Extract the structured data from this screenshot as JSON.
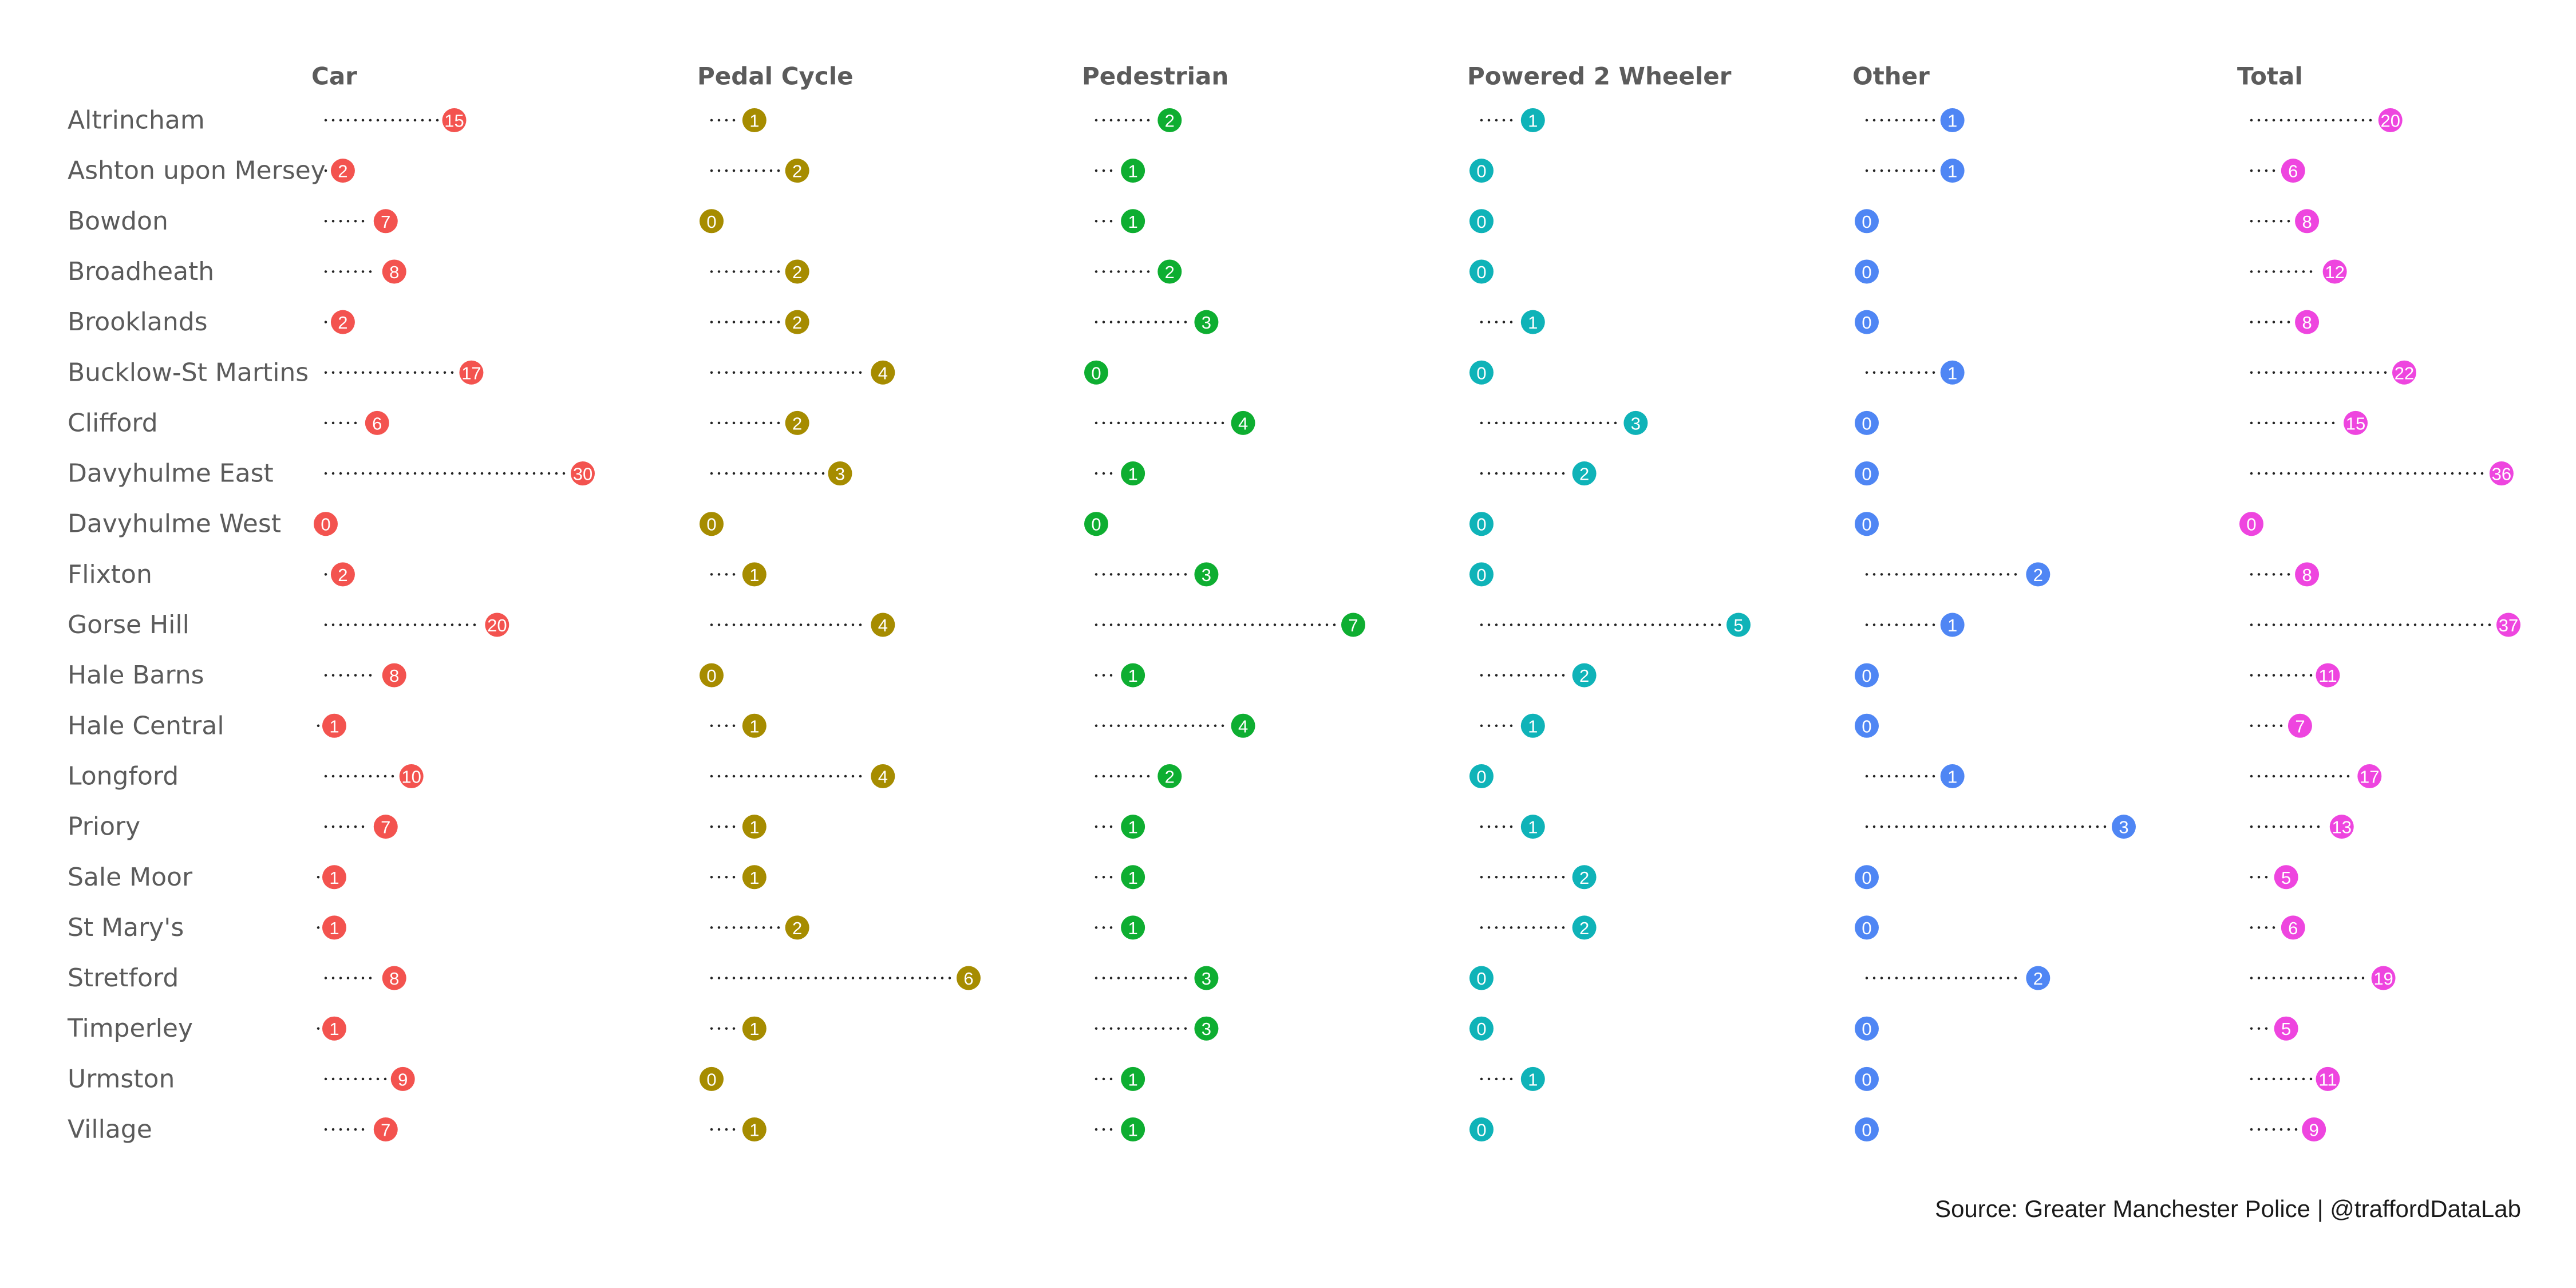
{
  "chart_data": {
    "type": "dot-strip",
    "categories": [
      "Altrincham",
      "Ashton upon Mersey",
      "Bowdon",
      "Broadheath",
      "Brooklands",
      "Bucklow-St Martins",
      "Clifford",
      "Davyhulme East",
      "Davyhulme West",
      "Flixton",
      "Gorse Hill",
      "Hale Barns",
      "Hale Central",
      "Longford",
      "Priory",
      "Sale Moor",
      "St Mary's",
      "Stretford",
      "Timperley",
      "Urmston",
      "Village"
    ],
    "series": [
      {
        "name": "Car",
        "color": "#F3534F",
        "values": [
          15,
          2,
          7,
          8,
          2,
          17,
          6,
          30,
          0,
          2,
          20,
          8,
          1,
          10,
          7,
          1,
          1,
          8,
          1,
          9,
          7
        ]
      },
      {
        "name": "Pedal Cycle",
        "color": "#A68C00",
        "values": [
          1,
          2,
          0,
          2,
          2,
          4,
          2,
          3,
          0,
          1,
          4,
          0,
          1,
          4,
          1,
          1,
          2,
          6,
          1,
          0,
          1
        ]
      },
      {
        "name": "Pedestrian",
        "color": "#0EAE31",
        "values": [
          2,
          1,
          1,
          2,
          3,
          0,
          4,
          1,
          0,
          3,
          7,
          1,
          4,
          2,
          1,
          1,
          1,
          3,
          3,
          1,
          1
        ]
      },
      {
        "name": "Powered 2 Wheeler",
        "color": "#0FB3B8",
        "values": [
          1,
          0,
          0,
          0,
          1,
          0,
          3,
          2,
          0,
          0,
          5,
          2,
          1,
          0,
          1,
          2,
          2,
          0,
          0,
          1,
          0
        ]
      },
      {
        "name": "Other",
        "color": "#4F86F4",
        "values": [
          1,
          1,
          0,
          0,
          0,
          1,
          0,
          0,
          0,
          2,
          1,
          0,
          0,
          1,
          3,
          0,
          0,
          2,
          0,
          0,
          0
        ]
      },
      {
        "name": "Total",
        "color": "#EE45DF",
        "values": [
          20,
          6,
          8,
          12,
          8,
          22,
          15,
          36,
          0,
          8,
          37,
          11,
          7,
          17,
          13,
          5,
          6,
          19,
          5,
          11,
          9
        ]
      }
    ]
  },
  "caption": "Source: Greater Manchester Police  |  @traffordDataLab"
}
